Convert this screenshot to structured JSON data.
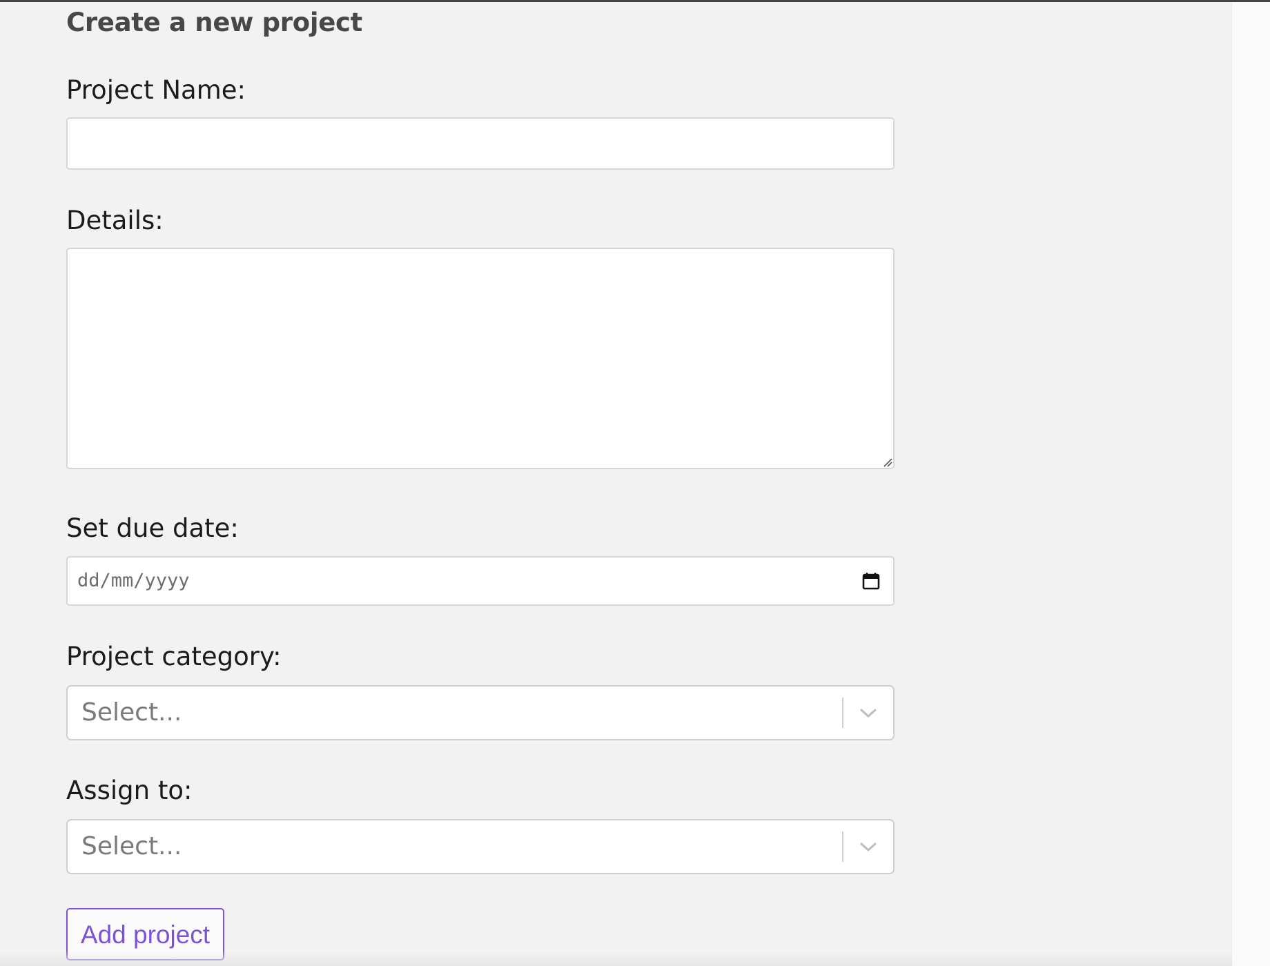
{
  "page": {
    "title": "Create a new project"
  },
  "form": {
    "project_name": {
      "label": "Project Name:",
      "value": ""
    },
    "details": {
      "label": "Details:",
      "value": ""
    },
    "due_date": {
      "label": "Set due date:",
      "placeholder": "dd/mm/yyyy"
    },
    "category": {
      "label": "Project category:",
      "placeholder": "Select..."
    },
    "assign_to": {
      "label": "Assign to:",
      "placeholder": "Select..."
    },
    "submit_label": "Add project"
  },
  "icons": {
    "calendar": "calendar-icon",
    "chevron": "chevron-down-icon",
    "resize": "resize-grip-icon"
  },
  "colors": {
    "accent": "#7d52d9",
    "background": "#f2f2f2",
    "title": "#474747",
    "placeholder": "#7a7a7a"
  }
}
